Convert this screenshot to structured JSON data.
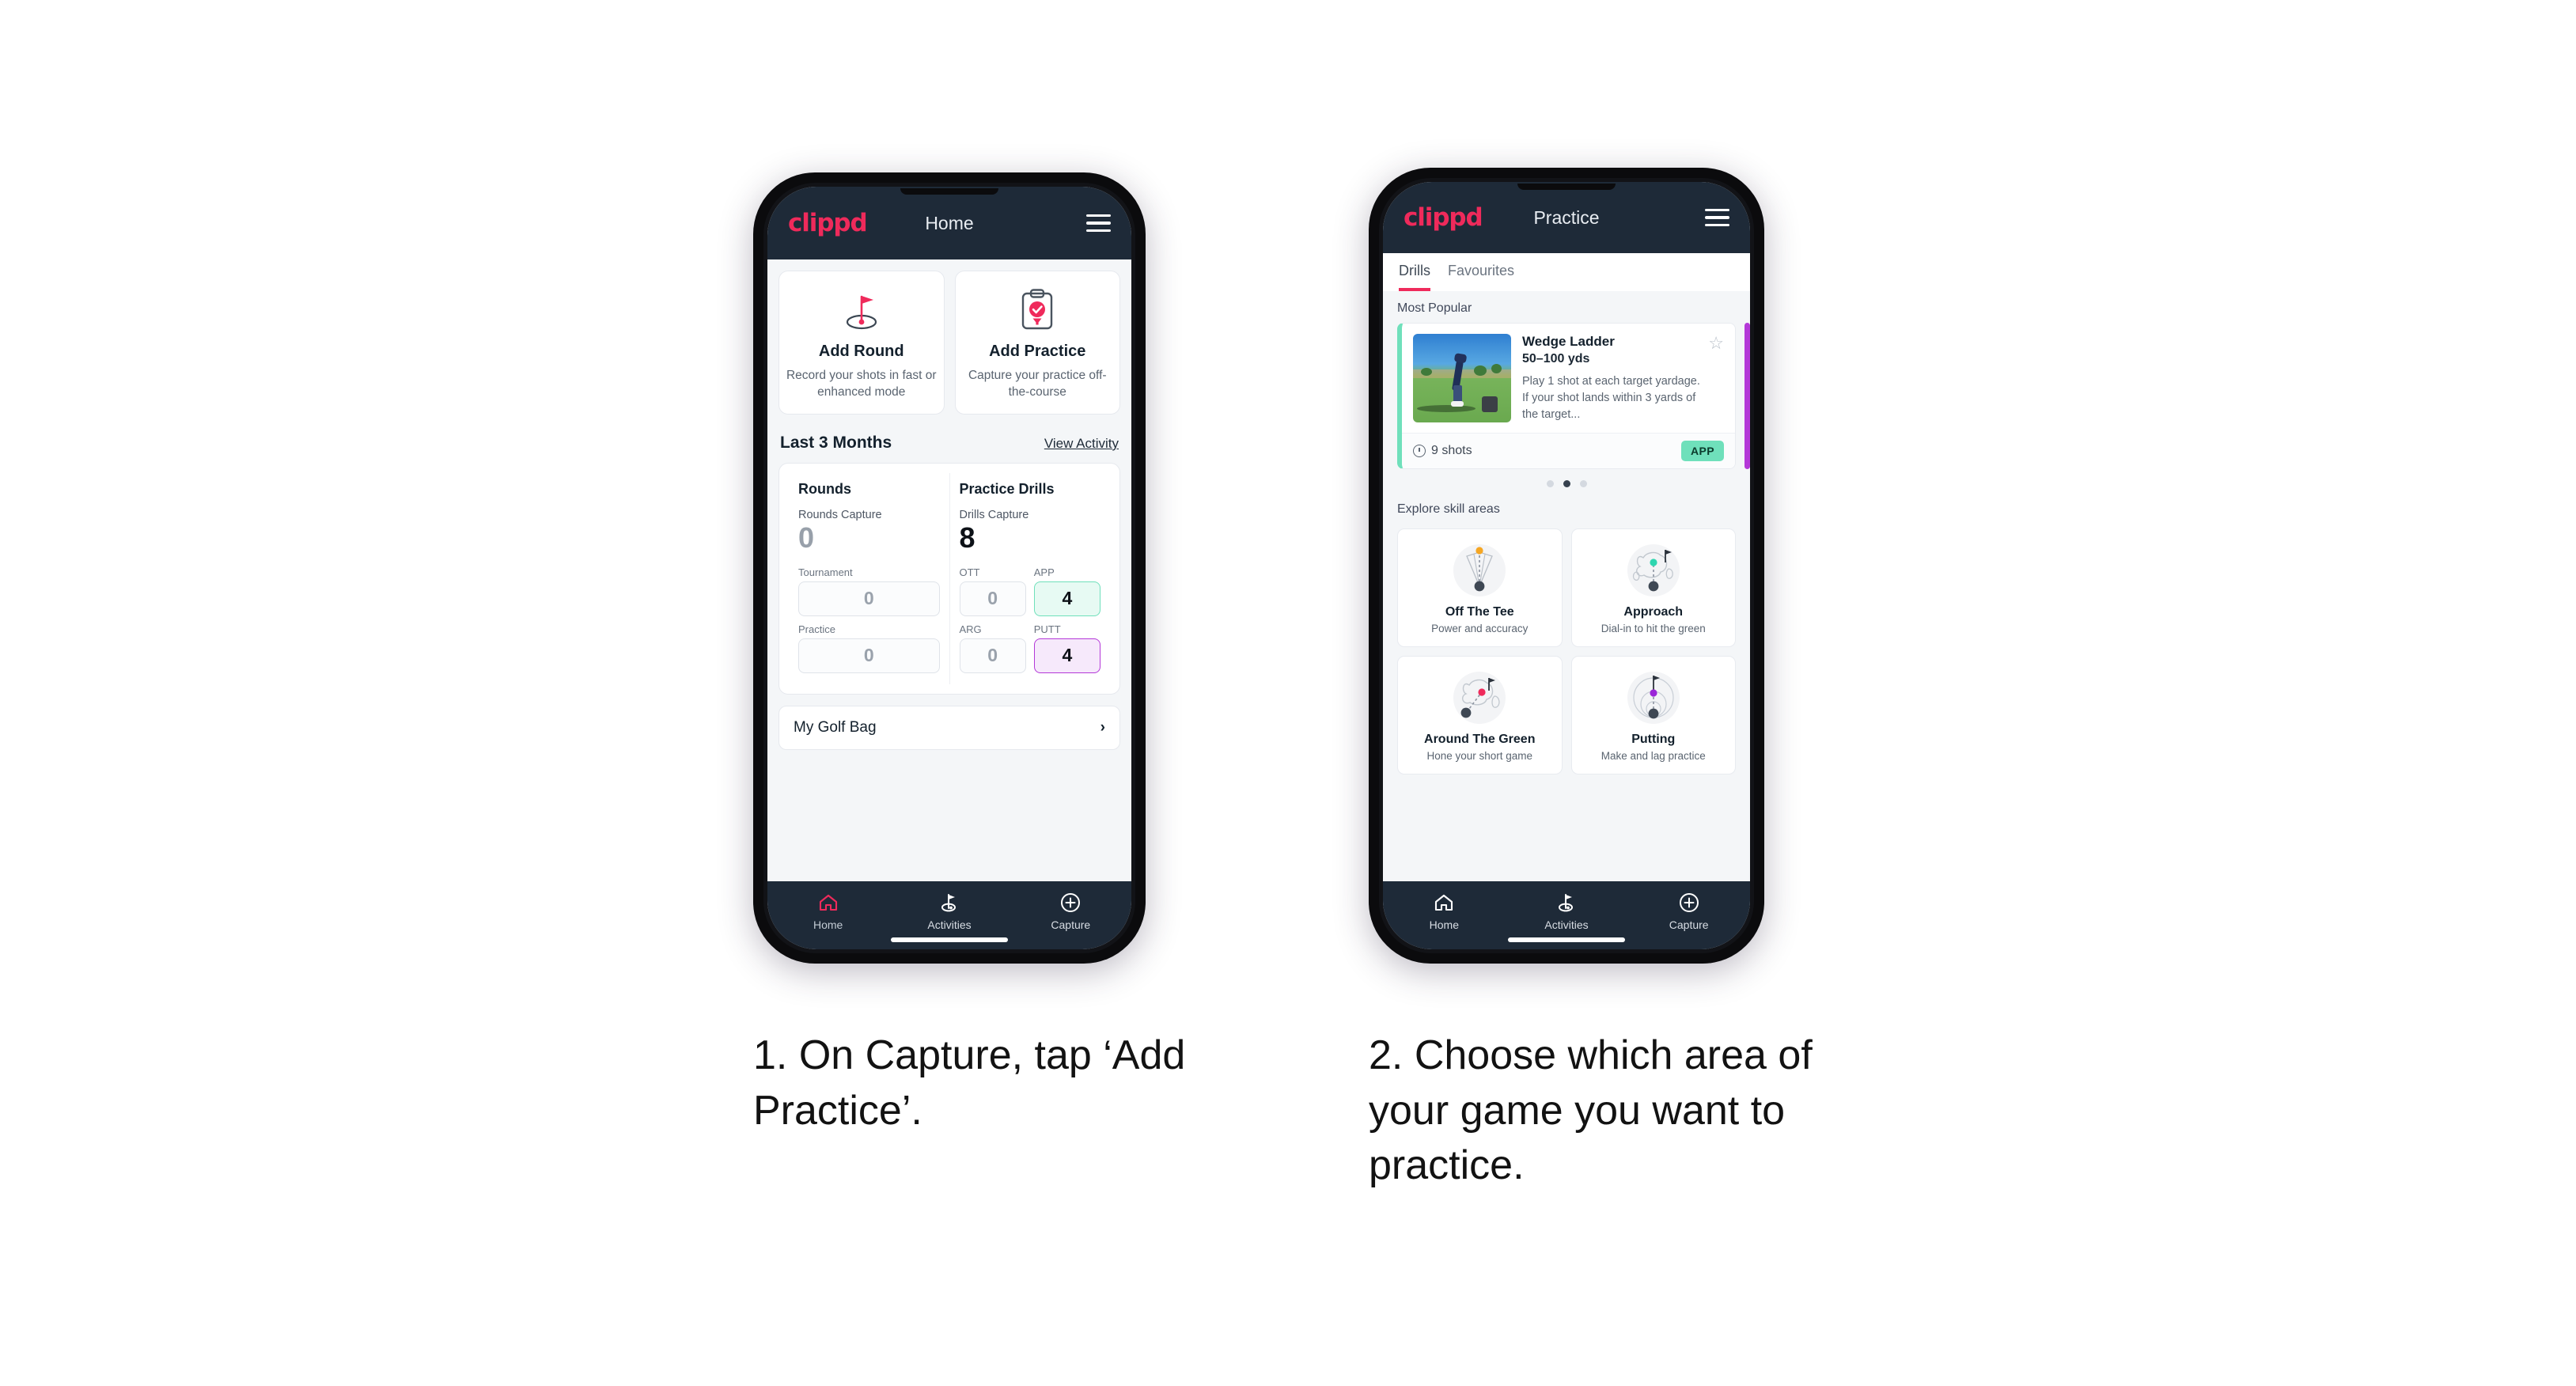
{
  "phone1": {
    "header": {
      "brand": "clippd",
      "title": "Home",
      "menu_icon": "hamburger-icon"
    },
    "actions": [
      {
        "icon": "golf-flag-hole-icon",
        "title": "Add Round",
        "subtitle": "Record your shots in fast or enhanced mode"
      },
      {
        "icon": "clipboard-check-icon",
        "title": "Add Practice",
        "subtitle": "Capture your practice off-the-course"
      }
    ],
    "section": {
      "title": "Last 3 Months",
      "link": "View Activity"
    },
    "rounds": {
      "title": "Rounds",
      "capture_label": "Rounds Capture",
      "capture_value": "0",
      "fields": [
        {
          "label": "Tournament",
          "value": "0",
          "state": "empty"
        },
        {
          "label": "Practice",
          "value": "0",
          "state": "empty"
        }
      ]
    },
    "drills": {
      "title": "Practice Drills",
      "capture_label": "Drills Capture",
      "capture_value": "8",
      "fields": [
        {
          "label": "OTT",
          "value": "0",
          "state": "empty"
        },
        {
          "label": "APP",
          "value": "4",
          "state": "app"
        },
        {
          "label": "ARG",
          "value": "0",
          "state": "empty"
        },
        {
          "label": "PUTT",
          "value": "4",
          "state": "putt"
        }
      ]
    },
    "bag": {
      "label": "My Golf Bag",
      "chevron": "chevron-right-icon"
    },
    "nav": [
      {
        "icon": "home-icon",
        "label": "Home",
        "active": true
      },
      {
        "icon": "golf-flag-icon",
        "label": "Activities",
        "active": false
      },
      {
        "icon": "plus-circle-icon",
        "label": "Capture",
        "active": false
      }
    ]
  },
  "phone2": {
    "header": {
      "brand": "clippd",
      "title": "Practice",
      "menu_icon": "hamburger-icon"
    },
    "tabs": [
      {
        "label": "Drills",
        "active": true
      },
      {
        "label": "Favourites",
        "active": false
      }
    ],
    "most_popular_label": "Most Popular",
    "drill": {
      "title": "Wedge Ladder",
      "yardage": "50–100 yds",
      "description": "Play 1 shot at each target yardage. If your shot lands within 3 yards of the target...",
      "shots": "9 shots",
      "badge": "APP",
      "star_icon": "star-outline-icon",
      "clock_icon": "clock-icon",
      "accent_color": "#6fe0bb",
      "next_accent_color": "#b438d8"
    },
    "carousel_dots": {
      "count": 3,
      "active_index": 1
    },
    "skills_label": "Explore skill areas",
    "skills": [
      {
        "icon": "off-the-tee-icon",
        "title": "Off The Tee",
        "subtitle": "Power and accuracy",
        "dot_color": "#f5a623"
      },
      {
        "icon": "approach-icon",
        "title": "Approach",
        "subtitle": "Dial-in to hit the green",
        "dot_color": "#2fd6b0"
      },
      {
        "icon": "around-the-green-icon",
        "title": "Around The Green",
        "subtitle": "Hone your short game",
        "dot_color": "#ef2a5b"
      },
      {
        "icon": "putting-icon",
        "title": "Putting",
        "subtitle": "Make and lag practice",
        "dot_color": "#9b27d8"
      }
    ],
    "nav": [
      {
        "icon": "home-icon",
        "label": "Home",
        "active": false
      },
      {
        "icon": "golf-flag-icon",
        "label": "Activities",
        "active": false
      },
      {
        "icon": "plus-circle-icon",
        "label": "Capture",
        "active": false
      }
    ]
  },
  "captions": {
    "one": "1. On Capture, tap ‘Add Practice’.",
    "two": "2. Choose which area of your game you want to practice."
  },
  "colors": {
    "brand_pink": "#ef2a5b",
    "dark_navy": "#1e2a38",
    "app_green": "#6fe0bb",
    "putt_purple": "#b438d8"
  }
}
